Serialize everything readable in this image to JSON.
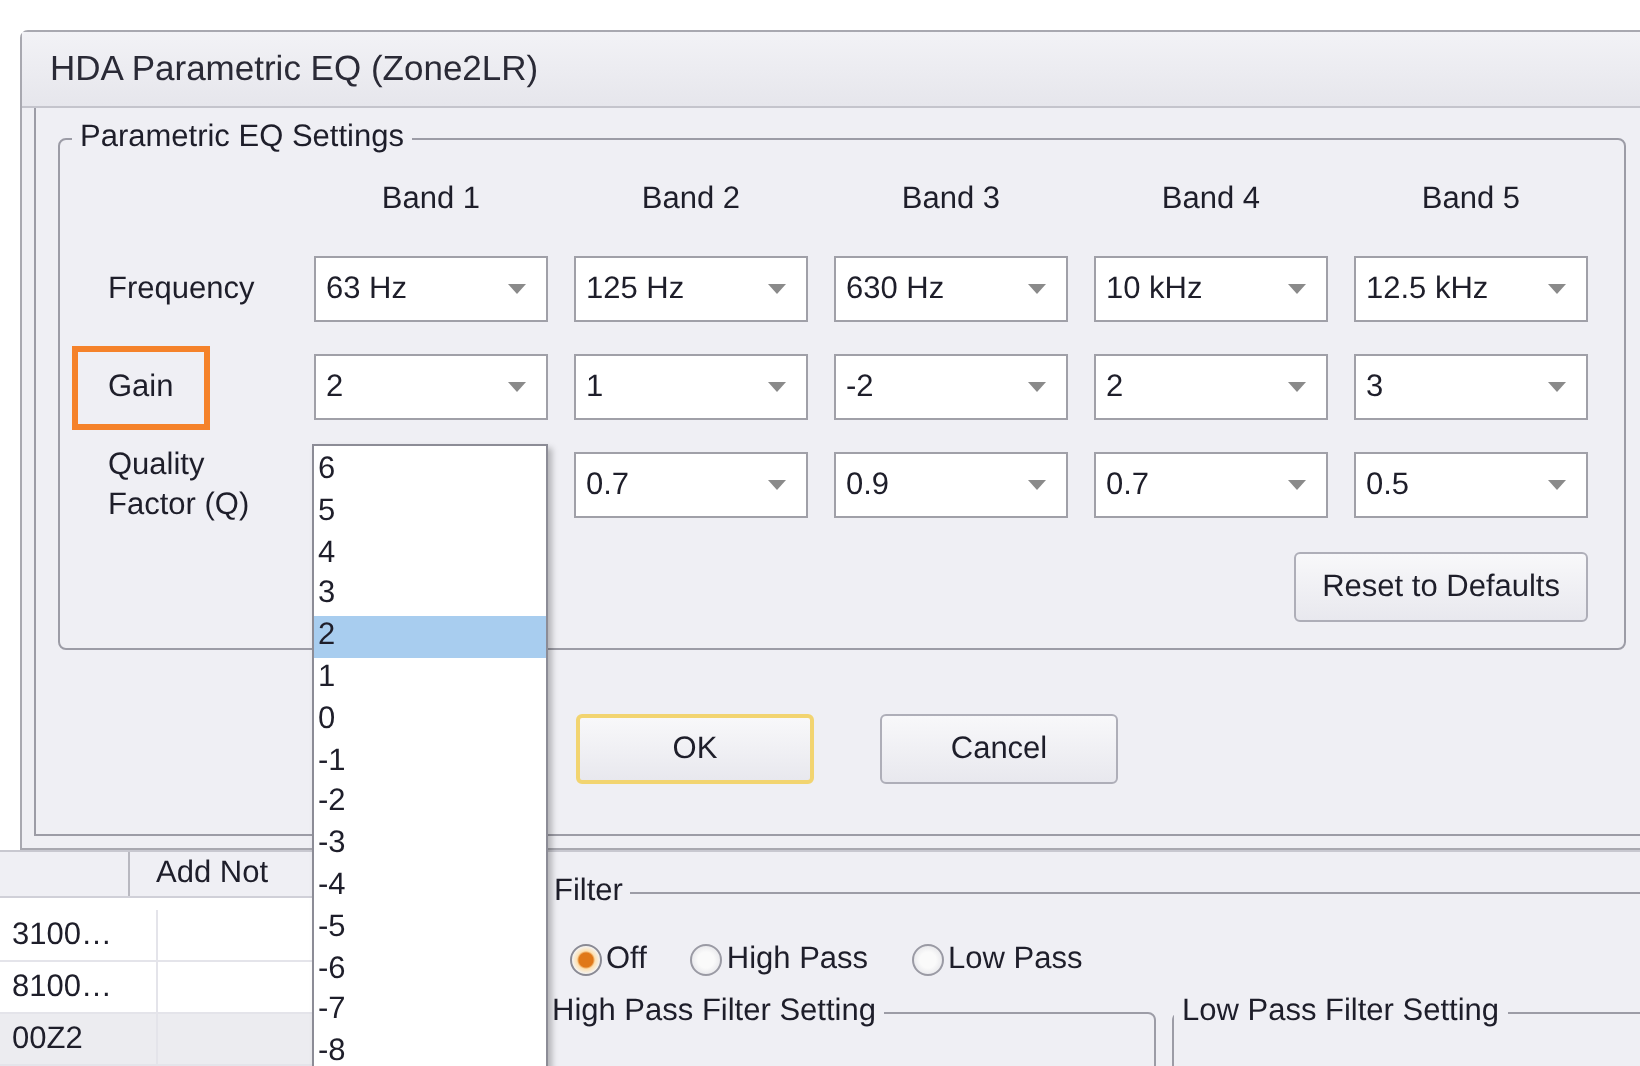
{
  "background_window": {
    "table": {
      "column_2_header": "Add Not",
      "rows": [
        {
          "column_1": "3100…",
          "selected": false
        },
        {
          "column_1": "8100…",
          "selected": false
        },
        {
          "column_1": "00Z2",
          "selected": true
        }
      ]
    },
    "filter_panel": {
      "title": "Filter",
      "modes": [
        {
          "label": "Off",
          "selected": true
        },
        {
          "label": "High Pass",
          "selected": false
        },
        {
          "label": "Low Pass",
          "selected": false
        }
      ],
      "subgroups": [
        "High Pass Filter Setting",
        "Low Pass Filter Setting"
      ]
    }
  },
  "dialog": {
    "title": "HDA Parametric EQ (Zone2LR)",
    "group_title": "Parametric EQ Settings",
    "bands": [
      "Band 1",
      "Band 2",
      "Band 3",
      "Band 4",
      "Band 5"
    ],
    "rows": [
      {
        "label": "Frequency",
        "highlighted": false,
        "values": [
          "63 Hz",
          "125 Hz",
          "630 Hz",
          "10 kHz",
          "12.5 kHz"
        ]
      },
      {
        "label": "Gain",
        "highlighted": true,
        "values": [
          "2",
          "1",
          "-2",
          "2",
          "3"
        ]
      },
      {
        "label": "Quality Factor (Q)",
        "highlighted": false,
        "values": [
          {
            "covered": true
          },
          "0.7",
          "0.9",
          "0.7",
          "0.5"
        ]
      }
    ],
    "reset_button": "Reset to Defaults",
    "buttons": [
      {
        "label": "OK",
        "focused": true
      },
      {
        "label": "Cancel",
        "focused": false
      }
    ]
  },
  "dropdown": {
    "items": [
      {
        "label": "6",
        "selected": false
      },
      {
        "label": "5",
        "selected": false
      },
      {
        "label": "4",
        "selected": false
      },
      {
        "label": "3",
        "selected": false
      },
      {
        "label": "2",
        "selected": true
      },
      {
        "label": "1",
        "selected": false
      },
      {
        "label": "0",
        "selected": false
      },
      {
        "label": "-1",
        "selected": false
      },
      {
        "label": "-2",
        "selected": false
      },
      {
        "label": "-3",
        "selected": false
      },
      {
        "label": "-4",
        "selected": false
      },
      {
        "label": "-5",
        "selected": false
      },
      {
        "label": "-6",
        "selected": false
      },
      {
        "label": "-7",
        "selected": false
      },
      {
        "label": "-8",
        "selected": false
      }
    ]
  }
}
